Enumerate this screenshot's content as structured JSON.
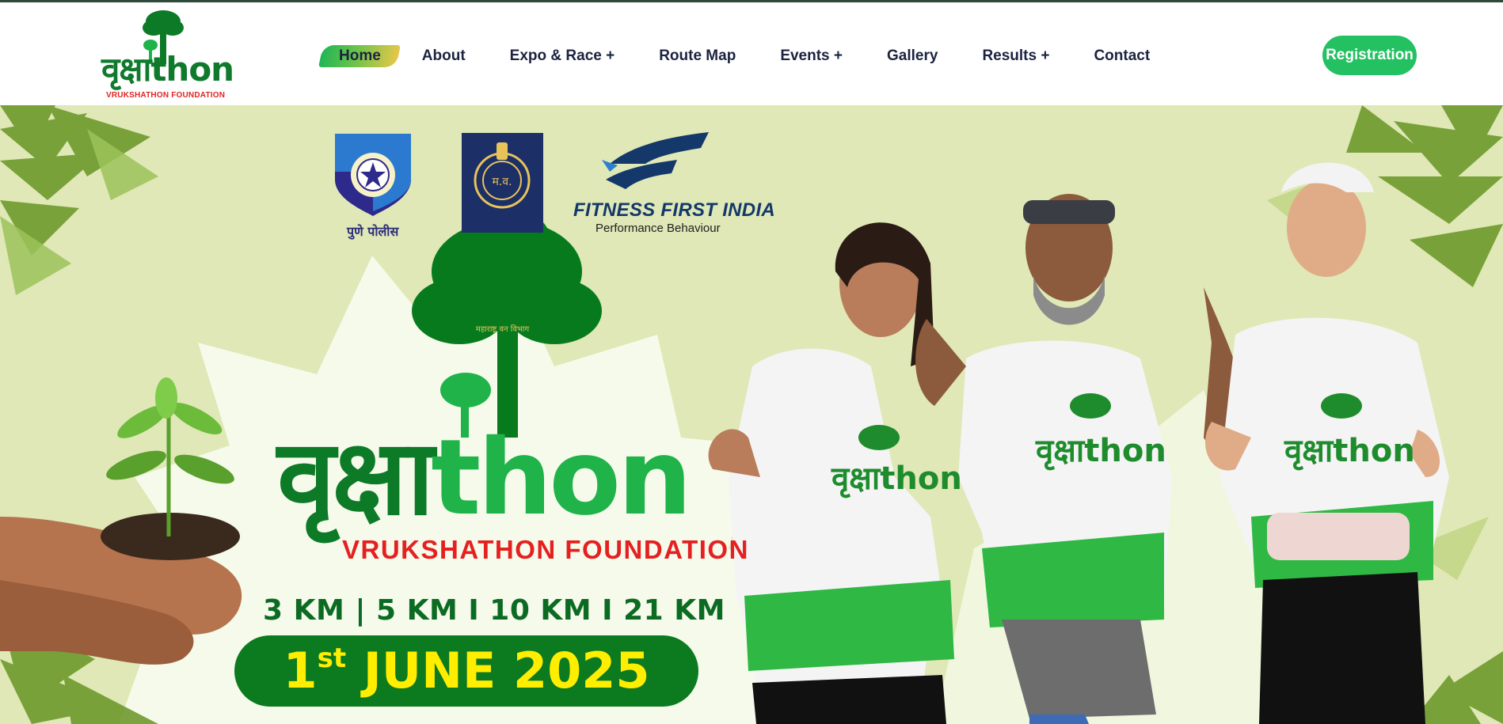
{
  "header": {
    "logo": {
      "wordmark": "वृक्षाthon",
      "subtitle": "VRUKSHATHON FOUNDATION"
    },
    "nav": [
      {
        "label": "Home",
        "active": true
      },
      {
        "label": "About"
      },
      {
        "label": "Expo & Race +"
      },
      {
        "label": "Route Map"
      },
      {
        "label": "Events +"
      },
      {
        "label": "Gallery"
      },
      {
        "label": "Results +"
      },
      {
        "label": "Contact"
      }
    ],
    "registration_label": "Registration"
  },
  "hero": {
    "partners": {
      "police_caption": "पुणे पोलीस",
      "forest_caption": "महाराष्ट्र वन विभाग",
      "fitness_title": "FITNESS FIRST INDIA",
      "fitness_subtitle": "Performance Behaviour"
    },
    "title_devanagari": "वृक्षा",
    "title_latin": "thon",
    "foundation": "VRUKSHATHON FOUNDATION",
    "distances": "3 KM | 5 KM I 10 KM I 21 KM",
    "date_day": "1",
    "date_suffix": "st",
    "date_rest": "JUNE 2025"
  },
  "colors": {
    "brand_green": "#0c7a26",
    "accent_green": "#24c162",
    "hero_bg": "#dfe8b6",
    "date_yellow": "#ffee00",
    "foundation_red": "#e52020",
    "nav_text": "#1b2340"
  }
}
